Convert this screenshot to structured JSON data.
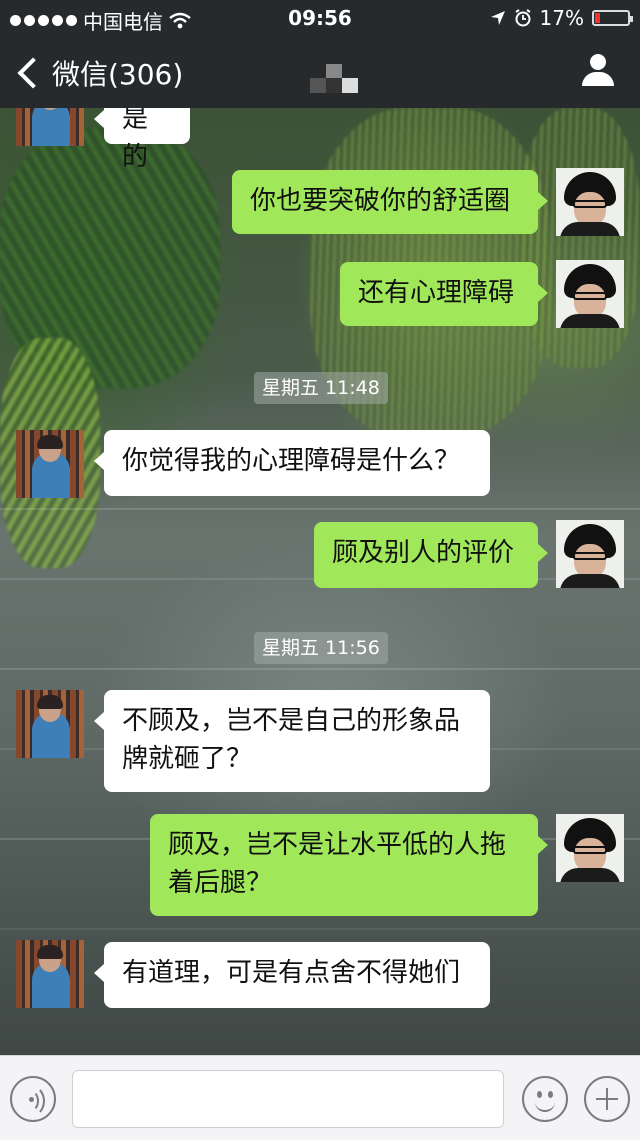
{
  "status_bar": {
    "carrier": "中国电信",
    "time": "09:56",
    "battery": "17%",
    "battery_level": 0.17,
    "icons": [
      "signal-dots-icon",
      "wifi-icon",
      "location-arrow-icon",
      "alarm-icon",
      "battery-icon"
    ]
  },
  "nav": {
    "back_label": "微信(306)",
    "profile_icon": "person-icon"
  },
  "messages": {
    "m0": {
      "side": "in",
      "text": "是的"
    },
    "m1": {
      "side": "out",
      "text": "你也要突破你的舒适圈"
    },
    "m2": {
      "side": "out",
      "text": "还有心理障碍"
    },
    "t1": "星期五 11:48",
    "m3": {
      "side": "in",
      "text": "你觉得我的心理障碍是什么？"
    },
    "m4": {
      "side": "out",
      "text": "顾及别人的评价"
    },
    "t2": "星期五 11:56",
    "m5": {
      "side": "in",
      "line1": "不顾及，岂不是自己的形象品",
      "line2": "牌就砸了？"
    },
    "m6": {
      "side": "out",
      "line1": "顾及，岂不是让水平低的人拖",
      "line2": "着后腿？"
    },
    "m7": {
      "side": "in",
      "text": "有道理，可是有点舍不得她们"
    }
  },
  "input_bar": {
    "voice_icon": "voice-icon",
    "text_value": "",
    "emoji_icon": "emoji-icon",
    "plus_icon": "plus-icon"
  },
  "colors": {
    "bar_bg": "#262a2d",
    "incoming_bubble": "#ffffff",
    "outgoing_bubble": "#a0e75a",
    "battery_low": "#ee3333"
  }
}
